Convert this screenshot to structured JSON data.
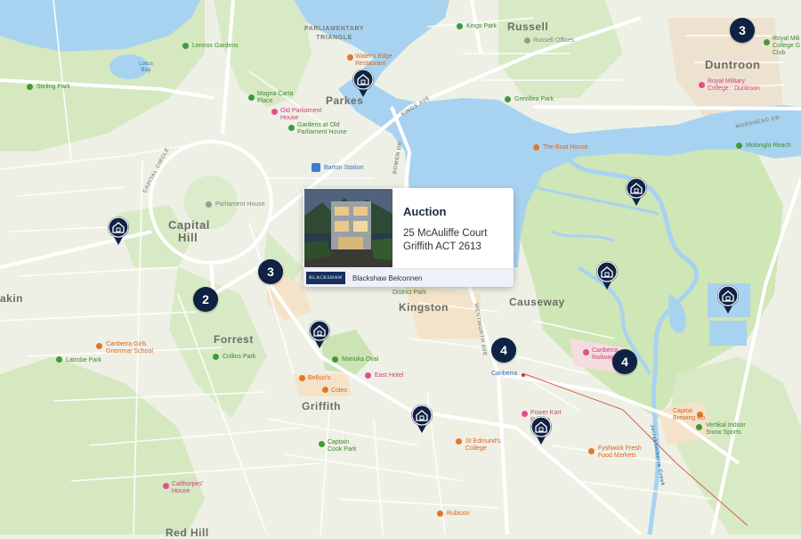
{
  "listing": {
    "status": "Auction",
    "address_line1": "25 McAuliffe Court",
    "address_line2": "Griffith ACT 2613",
    "agency_logo_text": "BLACKSHAW",
    "agency_name": "Blackshaw Belconnen"
  },
  "clusters": [
    "3",
    "3",
    "2",
    "4",
    "4"
  ],
  "suburbs": {
    "russell": "Russell",
    "duntroon": "Duntroon",
    "parkes": "Parkes",
    "capital_hill_1": "Capital",
    "capital_hill_2": "Hill",
    "forrest": "Forrest",
    "kingston": "Kingston",
    "causeway": "Causeway",
    "griffith": "Griffith",
    "akin": "akin",
    "red_hill": "Red Hill"
  },
  "area_labels": {
    "parliamentary_triangle": "PARLIAMENTARY\nTRIANGLE",
    "capital_circle": "CAPITAL CIRCLE",
    "kings_ave": "KINGS AVE",
    "bowen_dr": "BOWEN DR",
    "wentworth_ave": "WENTWORTH AVE",
    "morshead_dr": "MORSHEAD DR",
    "jerrabomberra_creek": "Jerrabomberra Creek",
    "lotus_bay": "Lotus\nBay"
  },
  "pois": {
    "lennox_gardens": "Lennox Gardens",
    "stirling_park": "Stirling Park",
    "kings_park": "Kings Park",
    "russell_offices": "Russell Offices",
    "waters_edge": "Water's Edge\nRestaurant",
    "magna_carta": "Magna Carta\nPlace",
    "old_parliament": "Old Parliament\nHouse",
    "gardens_old_parliament": "Gardens at Old\nParliament House",
    "grevillea_park": "Grevillea Park",
    "royal_military_college": "Royal Military\nCollege - Duntroon",
    "royal_military_golf": "Royal Mili\nCollege G\nClub",
    "the_boat_house": "The Boat House",
    "molonglo_reach": "Molonglo Reach",
    "barton_station": "Barton Station",
    "parliament_house": "Parliament House",
    "district_park": "District Park",
    "canberra_girls": "Canberra Girls\nGrammar School",
    "latrobe_park": "Latrobe Park",
    "collins_park": "Collins Park",
    "manuka_oval": "Manuka Oval",
    "east_hotel": "East Hotel",
    "bellucis": "Belluci's",
    "coles": "Coles",
    "canberra": "Canberra",
    "canberra_railway": "Canberra\nRailway",
    "power_kart": "Power Kart\nRacing",
    "capital_brewing": "Capital\nBrewing Co.",
    "vertikal": "Vertikal Indoor\nSnow Sports",
    "st_edmunds": "St Edmund's\nCollege",
    "fyshwick": "Fyshwick Fresh\nFood Markets",
    "captain_cook": "Captain\nCook Park",
    "calthorpes": "Calthorpes'\nHouse",
    "rubicon": "Rubicon"
  },
  "colors": {
    "water": "#a8d3f0",
    "park": "#cfe6b6",
    "land": "#eef0e6",
    "road": "#ffffff",
    "pin": "#0f2244",
    "cluster": "#0f2244"
  }
}
